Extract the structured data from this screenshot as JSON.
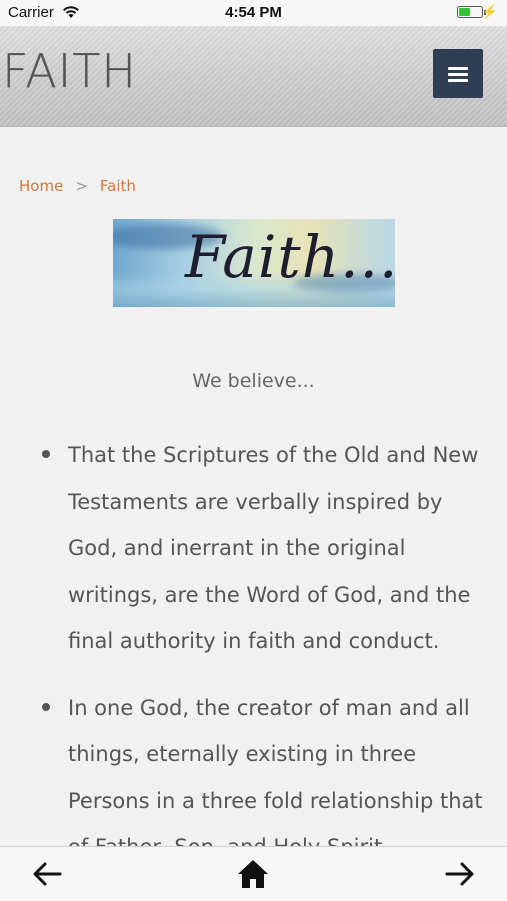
{
  "status_bar": {
    "carrier": "Carrier",
    "time": "4:54 PM"
  },
  "header": {
    "title": "FAITH",
    "menu_icon": "hamburger-menu-icon"
  },
  "breadcrumb": {
    "home": "Home",
    "separator": ">",
    "current": "Faith"
  },
  "banner": {
    "text": "Faith..."
  },
  "content": {
    "lead": "We believe...",
    "items": [
      "That the Scriptures of the Old and New Testaments are verbally inspired by God, and inerrant in the original writings, are the Word of God, and the final authority in faith and conduct.",
      "In one God, the creator of man and all things, eternally existing in three Persons in a three fold relationship that of Father, Son, and Holy Spirit."
    ]
  },
  "toolbar": {
    "back_icon": "arrow-left-icon",
    "home_icon": "home-icon",
    "forward_icon": "arrow-right-icon"
  },
  "colors": {
    "accent": "#d0783a",
    "menu_bg": "#2f3e52",
    "text": "#555555",
    "battery": "#33c533"
  }
}
